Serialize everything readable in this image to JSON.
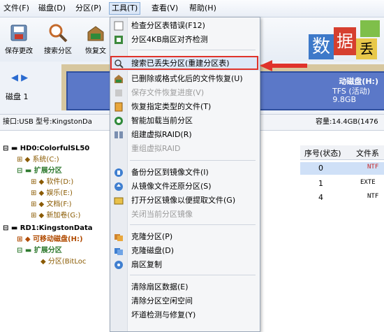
{
  "menubar": {
    "items": [
      {
        "label": "文件(F)"
      },
      {
        "label": "磁盘(D)"
      },
      {
        "label": "分区(P)"
      },
      {
        "label": "工具(T)"
      },
      {
        "label": "查看(V)"
      },
      {
        "label": "帮助(H)"
      }
    ]
  },
  "toolbar": {
    "buttons": [
      {
        "label": "保存更改",
        "icon": "save-icon"
      },
      {
        "label": "搜索分区",
        "icon": "search-icon"
      },
      {
        "label": "恢复文",
        "icon": "recover-icon"
      }
    ]
  },
  "disk": {
    "label": "磁盘 1",
    "partition_title": "动磁盘(H:)",
    "partition_fs": "TFS (活动)",
    "partition_size": "9.8GB",
    "interface_label": "接口:USB  型号:KingstonDa",
    "capacity_label": "容量:14.4GB(1476"
  },
  "tree": {
    "rows": [
      {
        "text": "HD0:ColorfulSL50"
      },
      {
        "text": "系统(C:)"
      },
      {
        "text": "扩展分区"
      },
      {
        "text": "软件(D:)"
      },
      {
        "text": "娱乐(E:)"
      },
      {
        "text": "文档(F:)"
      },
      {
        "text": "新加卷(G:)"
      },
      {
        "text": "RD1:KingstonData"
      },
      {
        "text": "可移动磁盘(H:)"
      },
      {
        "text": "扩展分区"
      },
      {
        "text": "分区(BitLoc"
      }
    ]
  },
  "table": {
    "columns": [
      "序号(状态)",
      "文件系"
    ],
    "rows": [
      {
        "index": "0",
        "fs": "NTF"
      },
      {
        "index": "1",
        "fs": "EXTE"
      },
      {
        "index": "4",
        "fs": "NTF"
      }
    ]
  },
  "tools_menu": {
    "items": [
      {
        "label": "检查分区表错误(F12)",
        "icon": "check-icon",
        "disabled": false
      },
      {
        "label": "分区4KB扇区对齐检测",
        "icon": "align-icon",
        "disabled": false
      },
      {
        "label": "搜索已丢失分区(重建分区表)",
        "icon": "search-icon",
        "disabled": false,
        "highlighted": true
      },
      {
        "label": "已删除或格式化后的文件恢复(U)",
        "icon": "restore-files-icon",
        "disabled": false
      },
      {
        "label": "保存文件恢复进度(V)",
        "icon": "save-progress-icon",
        "disabled": true
      },
      {
        "label": "恢复指定类型的文件(T)",
        "icon": "file-type-icon",
        "disabled": false
      },
      {
        "label": "智能加载当前分区",
        "icon": "smart-load-icon",
        "disabled": false
      },
      {
        "label": "组建虚拟RAID(R)",
        "icon": "raid-icon",
        "disabled": false
      },
      {
        "label": "重组虚拟RAID",
        "icon": "raid-rebuild-icon",
        "disabled": true
      },
      {
        "label": "备份分区到镜像文件(I)",
        "icon": "backup-icon",
        "disabled": false
      },
      {
        "label": "从镜像文件还原分区(S)",
        "icon": "image-restore-icon",
        "disabled": false
      },
      {
        "label": "打开分区镜像以便提取文件(G)",
        "icon": "open-image-icon",
        "disabled": false
      },
      {
        "label": "关闭当前分区镜像",
        "icon": "close-image-icon",
        "disabled": true
      },
      {
        "label": "克隆分区(P)",
        "icon": "clone-partition-icon",
        "disabled": false
      },
      {
        "label": "克隆磁盘(D)",
        "icon": "clone-disk-icon",
        "disabled": false
      },
      {
        "label": "扇区复制",
        "icon": "sector-copy-icon",
        "disabled": false
      },
      {
        "label": "清除扇区数据(E)",
        "icon": "erase-icon",
        "disabled": false
      },
      {
        "label": "清除分区空闲空间",
        "icon": "erase-free-icon",
        "disabled": false
      },
      {
        "label": "坏道检测与修复(Y)",
        "icon": "badsector-icon",
        "disabled": false
      }
    ]
  },
  "ad_badge": {
    "chars": [
      "数",
      "据",
      "丢"
    ]
  },
  "colors": {
    "highlight_red": "#e0332b",
    "disk_blue": "#5b78c8",
    "menu_bg": "#f5f6f8"
  }
}
